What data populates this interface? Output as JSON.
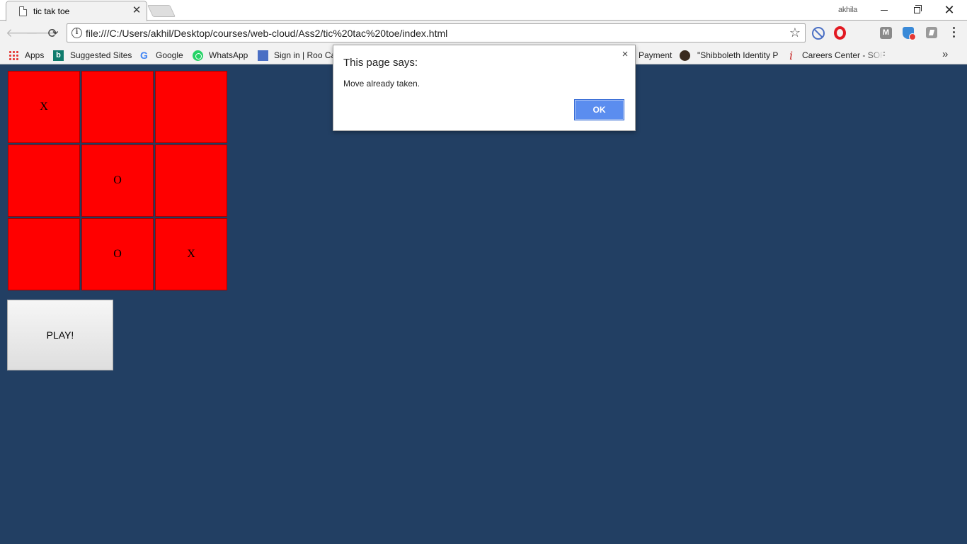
{
  "browser": {
    "tab_title": "tic tak toe",
    "tab_close": "✕",
    "profile_name": "akhila",
    "url": "file:///C:/Users/akhil/Desktop/courses/web-cloud/Ass2/tic%20tac%20toe/index.html",
    "window_controls": {
      "minimize": "minimize",
      "maximize": "restore",
      "close": "✕"
    }
  },
  "bookmarks": [
    {
      "label": "Apps",
      "icon": "apps-grid-icon"
    },
    {
      "label": "Suggested Sites",
      "icon": "bing-icon"
    },
    {
      "label": "Google",
      "icon": "google-icon"
    },
    {
      "label": "WhatsApp",
      "icon": "whatsapp-icon"
    },
    {
      "label": "Sign in | Roo Ca",
      "icon": "roo-icon"
    },
    {
      "label": "Payment",
      "icon": ""
    },
    {
      "label": "\"Shibboleth Identity P",
      "icon": "shibboleth-icon"
    },
    {
      "label": "Careers Center - SOF",
      "icon": "careers-icon"
    }
  ],
  "bookmarks_overflow": "»",
  "game": {
    "cells": [
      "X",
      "",
      "",
      "",
      "O",
      "",
      "",
      "O",
      "X"
    ],
    "cell_color": "#ff0000",
    "play_label": "PLAY!"
  },
  "page_background": "#223f63",
  "alert": {
    "title": "This page says:",
    "message": "Move already taken.",
    "ok_label": "OK",
    "close": "×"
  }
}
